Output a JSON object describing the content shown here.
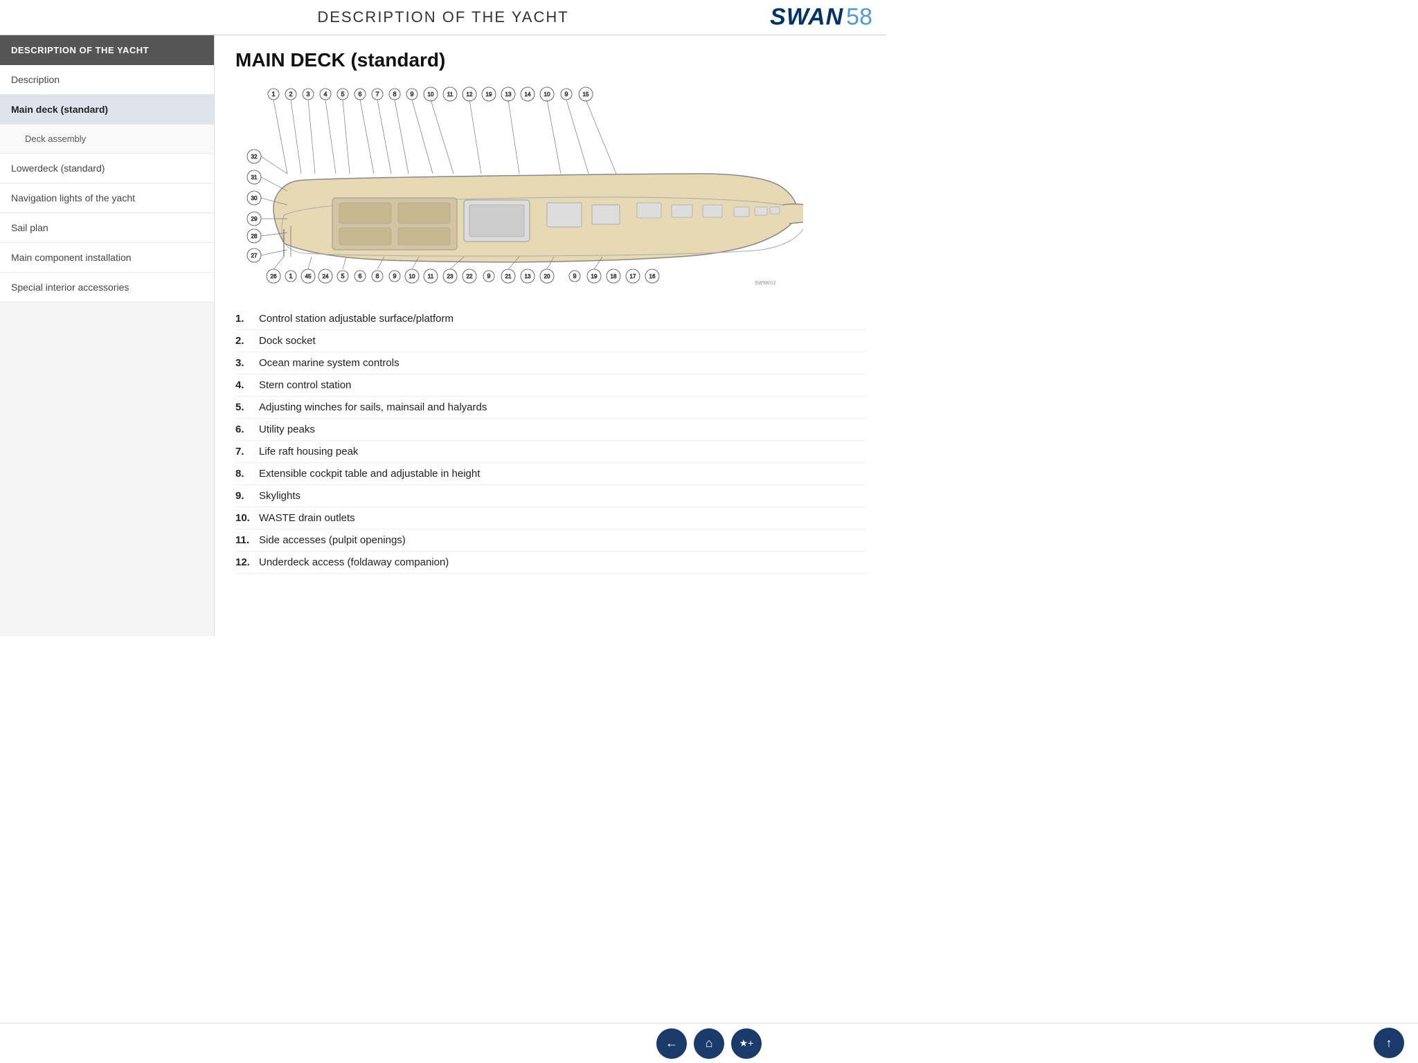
{
  "header": {
    "title": "DESCRIPTION OF THE YACHT",
    "logo_swan": "SWAN",
    "logo_num": "58"
  },
  "sidebar": {
    "header_label": "DESCRIPTION OF THE YACHT",
    "items": [
      {
        "id": "description",
        "label": "Description",
        "active": false,
        "sub": false
      },
      {
        "id": "main-deck",
        "label": "Main deck (standard)",
        "active": true,
        "sub": false
      },
      {
        "id": "deck-assembly",
        "label": "Deck assembly",
        "active": false,
        "sub": true
      },
      {
        "id": "lowerdeck",
        "label": "Lowerdeck (standard)",
        "active": false,
        "sub": false
      },
      {
        "id": "nav-lights",
        "label": "Navigation lights of the yacht",
        "active": false,
        "sub": false
      },
      {
        "id": "sail-plan",
        "label": "Sail plan",
        "active": false,
        "sub": false
      },
      {
        "id": "main-component",
        "label": "Main component installation",
        "active": false,
        "sub": false
      },
      {
        "id": "special-interior",
        "label": "Special interior accessories",
        "active": false,
        "sub": false
      }
    ]
  },
  "main": {
    "page_title": "MAIN DECK (standard)",
    "items": [
      {
        "num": "1.",
        "text": "Control station adjustable surface/platform"
      },
      {
        "num": "2.",
        "text": "Dock socket"
      },
      {
        "num": "3.",
        "text": "Ocean marine system controls"
      },
      {
        "num": "4.",
        "text": "Stern control station"
      },
      {
        "num": "5.",
        "text": "Adjusting winches for sails, mainsail and halyards"
      },
      {
        "num": "6.",
        "text": "Utility peaks"
      },
      {
        "num": "7.",
        "text": "Life raft housing peak"
      },
      {
        "num": "8.",
        "text": "Extensible cockpit table and adjustable in height"
      },
      {
        "num": "9.",
        "text": "Skylights"
      },
      {
        "num": "10.",
        "text": "WASTE drain outlets"
      },
      {
        "num": "11.",
        "text": "Side accesses (pulpit openings)"
      },
      {
        "num": "12.",
        "text": "Underdeck access (foldaway companion)"
      }
    ]
  },
  "bottom_nav": {
    "back_label": "←",
    "home_label": "⌂",
    "bookmark_label": "★+",
    "up_label": "↑"
  }
}
